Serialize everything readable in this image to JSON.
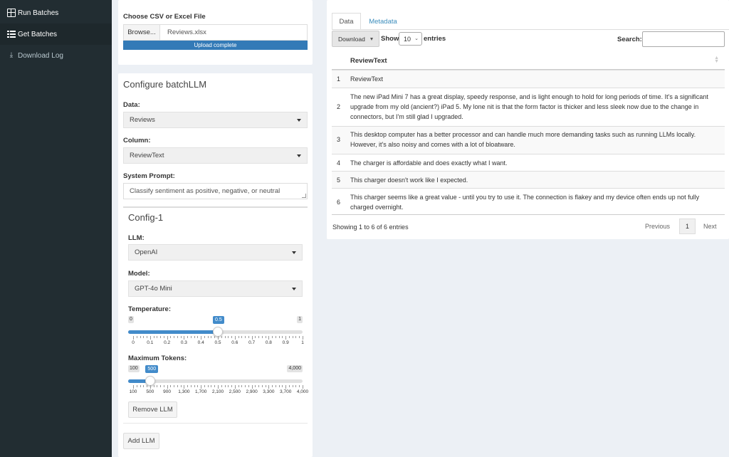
{
  "sidebar": {
    "items": [
      {
        "label": "Run Batches",
        "icon": "table-icon"
      },
      {
        "label": "Get Batches",
        "icon": "list-icon"
      },
      {
        "label": "Download Log",
        "icon": "download-icon"
      }
    ]
  },
  "upload": {
    "label": "Choose CSV or Excel File",
    "browse_label": "Browse...",
    "file_name": "Reviews.xlsx",
    "progress_text": "Upload complete",
    "progress": 1.0
  },
  "config": {
    "title": "Configure batchLLM",
    "data_label": "Data:",
    "data_value": "Reviews",
    "column_label": "Column:",
    "column_value": "ReviewText",
    "prompt_label": "System Prompt:",
    "prompt_value": "Classify sentiment as positive, negative, or neutral",
    "llm_config": {
      "title": "Config-1",
      "llm_label": "LLM:",
      "llm_value": "OpenAI",
      "model_label": "Model:",
      "model_value": "GPT-4o Mini",
      "temperature": {
        "label": "Temperature:",
        "min": "0",
        "max": "1",
        "value": "0.5",
        "fraction": 0.5,
        "ticks": [
          "0",
          "0.1",
          "0.2",
          "0.3",
          "0.4",
          "0.5",
          "0.6",
          "0.7",
          "0.8",
          "0.9",
          "1"
        ]
      },
      "max_tokens": {
        "label": "Maximum Tokens:",
        "min": "100",
        "max": "4,000",
        "value": "500",
        "fraction": 0.1026,
        "ticks": [
          "100",
          "500",
          "900",
          "1,300",
          "1,700",
          "2,100",
          "2,500",
          "2,900",
          "3,300",
          "3,700",
          "4,000"
        ]
      },
      "remove_label": "Remove LLM"
    },
    "add_label": "Add LLM"
  },
  "table_panel": {
    "tabs": [
      "Data",
      "Metadata"
    ],
    "download_label": "Download",
    "show_label": "Show",
    "entries_value": "10",
    "entries_label": "entries",
    "search_label": "Search:",
    "search_value": "",
    "column_header": "ReviewText",
    "rows": [
      {
        "num": "1",
        "text": "ReviewText"
      },
      {
        "num": "2",
        "text": "The new iPad Mini 7 has a great display, speedy response, and is light enough to hold for long periods of time. It's a significant upgrade from my old (ancient?) iPad 5. My lone nit is that the form factor is thicker and less sleek now due to the change in connectors, but I'm still glad I upgraded."
      },
      {
        "num": "3",
        "text": "This desktop computer has a better processor and can handle much more demanding tasks such as running LLMs locally. However, it's also noisy and comes with a lot of bloatware."
      },
      {
        "num": "4",
        "text": "The charger is affordable and does exactly what I want."
      },
      {
        "num": "5",
        "text": "This charger doesn't work like I expected."
      },
      {
        "num": "6",
        "text": "This charger seems like a great value - until you try to use it. The connection is flakey and my device often ends up not fully charged overnight."
      }
    ],
    "info": "Showing 1 to 6 of 6 entries",
    "prev_label": "Previous",
    "current_page": "1",
    "next_label": "Next"
  },
  "colors": {
    "sidebar_bg": "#222d32",
    "accent": "#337ab7",
    "slider": "#428bca",
    "page_bg": "#ecf0f5"
  }
}
